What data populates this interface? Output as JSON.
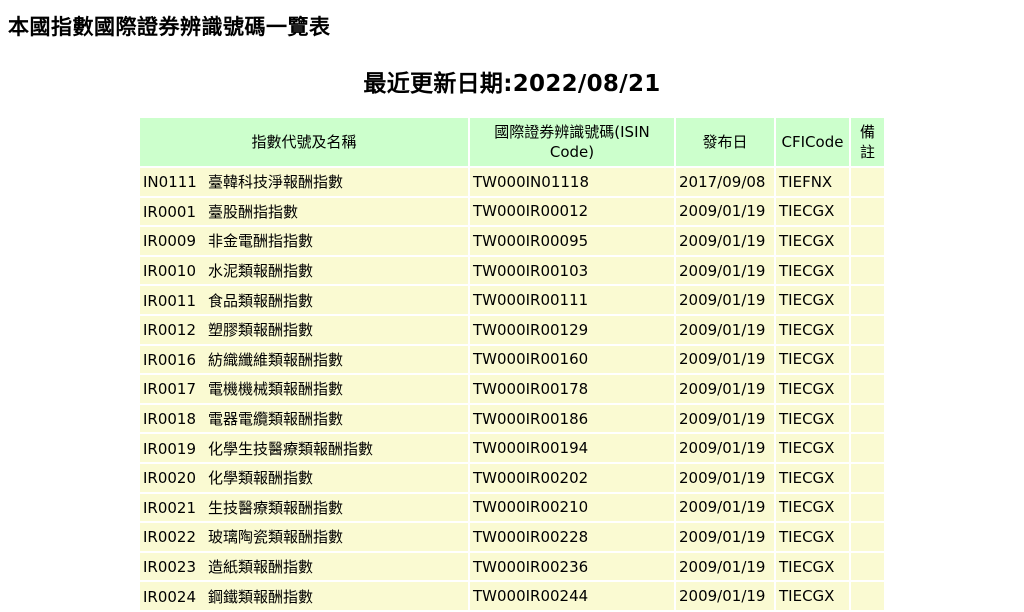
{
  "page": {
    "heading": "本國指數國際證券辨識號碼一覽表",
    "update_date": "最近更新日期:2022/08/21"
  },
  "table": {
    "headers": [
      "指數代號及名稱",
      "國際證券辨識號碼(ISIN Code)",
      "發布日",
      "CFICode",
      "備註"
    ],
    "rows": [
      {
        "code": "IN0111",
        "name": "臺韓科技淨報酬指數",
        "isin": "TW000IN01118",
        "date": "2017/09/08",
        "cfi": "TIEFNX",
        "note": ""
      },
      {
        "code": "IR0001",
        "name": "臺股酬指指數",
        "isin": "TW000IR00012",
        "date": "2009/01/19",
        "cfi": "TIECGX",
        "note": ""
      },
      {
        "code": "IR0009",
        "name": "非金電酬指指數",
        "isin": "TW000IR00095",
        "date": "2009/01/19",
        "cfi": "TIECGX",
        "note": ""
      },
      {
        "code": "IR0010",
        "name": "水泥類報酬指數",
        "isin": "TW000IR00103",
        "date": "2009/01/19",
        "cfi": "TIECGX",
        "note": ""
      },
      {
        "code": "IR0011",
        "name": "食品類報酬指數",
        "isin": "TW000IR00111",
        "date": "2009/01/19",
        "cfi": "TIECGX",
        "note": ""
      },
      {
        "code": "IR0012",
        "name": "塑膠類報酬指數",
        "isin": "TW000IR00129",
        "date": "2009/01/19",
        "cfi": "TIECGX",
        "note": ""
      },
      {
        "code": "IR0016",
        "name": "紡織纖維類報酬指數",
        "isin": "TW000IR00160",
        "date": "2009/01/19",
        "cfi": "TIECGX",
        "note": ""
      },
      {
        "code": "IR0017",
        "name": "電機機械類報酬指數",
        "isin": "TW000IR00178",
        "date": "2009/01/19",
        "cfi": "TIECGX",
        "note": ""
      },
      {
        "code": "IR0018",
        "name": "電器電纜類報酬指數",
        "isin": "TW000IR00186",
        "date": "2009/01/19",
        "cfi": "TIECGX",
        "note": ""
      },
      {
        "code": "IR0019",
        "name": "化學生技醫療類報酬指數",
        "isin": "TW000IR00194",
        "date": "2009/01/19",
        "cfi": "TIECGX",
        "note": ""
      },
      {
        "code": "IR0020",
        "name": "化學類報酬指數",
        "isin": "TW000IR00202",
        "date": "2009/01/19",
        "cfi": "TIECGX",
        "note": ""
      },
      {
        "code": "IR0021",
        "name": "生技醫療類報酬指數",
        "isin": "TW000IR00210",
        "date": "2009/01/19",
        "cfi": "TIECGX",
        "note": ""
      },
      {
        "code": "IR0022",
        "name": "玻璃陶瓷類報酬指數",
        "isin": "TW000IR00228",
        "date": "2009/01/19",
        "cfi": "TIECGX",
        "note": ""
      },
      {
        "code": "IR0023",
        "name": "造紙類報酬指數",
        "isin": "TW000IR00236",
        "date": "2009/01/19",
        "cfi": "TIECGX",
        "note": ""
      },
      {
        "code": "IR0024",
        "name": "鋼鐵類報酬指數",
        "isin": "TW000IR00244",
        "date": "2009/01/19",
        "cfi": "TIECGX",
        "note": ""
      }
    ]
  },
  "colors": {
    "header_bg": "#ccffcc",
    "row_bg": "#fafad2"
  }
}
